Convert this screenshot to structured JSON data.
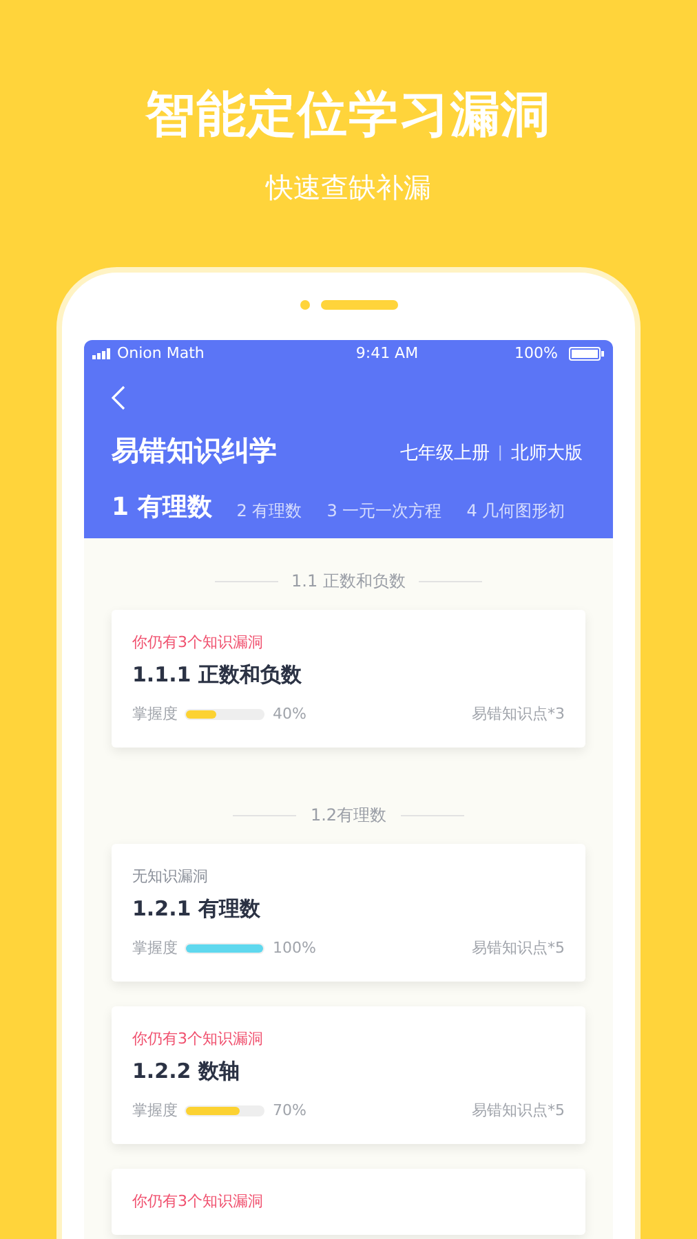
{
  "promo": {
    "headline": "智能定位学习漏洞",
    "subheadline": "快速查缺补漏"
  },
  "status_bar": {
    "carrier": "Onion Math",
    "time": "9:41 AM",
    "battery": "100%"
  },
  "header": {
    "title": "易错知识纠学",
    "grade": "七年级上册",
    "separator": "|",
    "edition": "北师大版"
  },
  "tabs": [
    {
      "label": "1 有理数",
      "selected": true
    },
    {
      "label": "2 有理数",
      "selected": false
    },
    {
      "label": "3 一元一次方程",
      "selected": false
    },
    {
      "label": "4 几何图形初",
      "selected": false
    }
  ],
  "sections": [
    {
      "heading": "1.1 正数和负数",
      "cards": [
        {
          "kind": "gaps",
          "status": "你仍有3个知识漏洞",
          "title": "1.1.1 正数和负数",
          "mastery_label": "掌握度",
          "level": 0.4,
          "percent": "40%",
          "points": "易错知识点*3"
        }
      ]
    },
    {
      "heading": "1.2有理数",
      "cards": [
        {
          "kind": "none",
          "status": "无知识漏洞",
          "title": "1.2.1 有理数",
          "mastery_label": "掌握度",
          "level": 1,
          "percent": "100%",
          "points": "易错知识点*5"
        },
        {
          "kind": "gaps",
          "status": "你仍有3个知识漏洞",
          "title": "1.2.2 数轴",
          "mastery_label": "掌握度",
          "level": 0.7,
          "percent": "70%",
          "points": "易错知识点*5"
        },
        {
          "kind": "gaps",
          "status": "你仍有3个知识漏洞"
        }
      ]
    }
  ]
}
